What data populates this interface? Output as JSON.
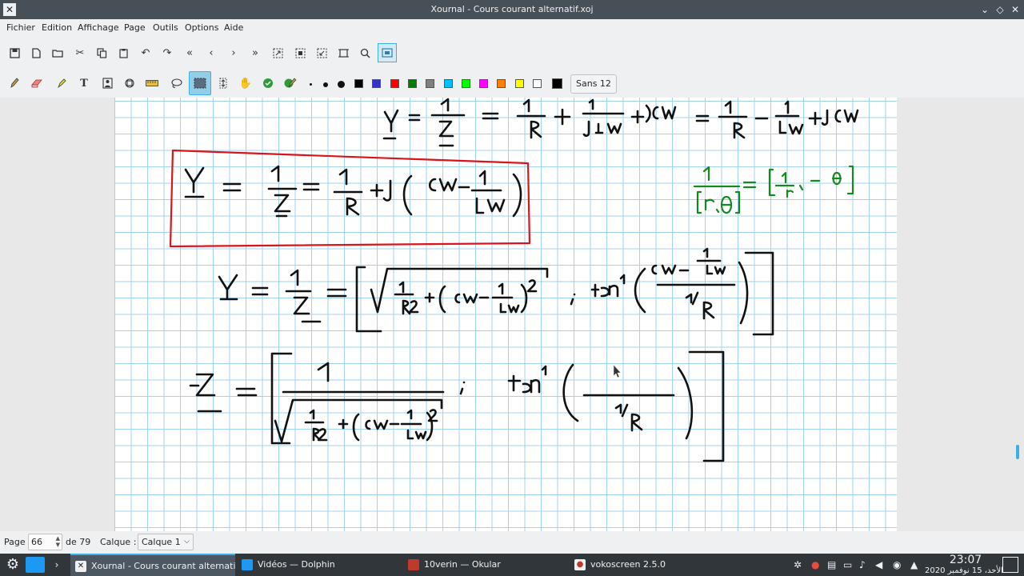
{
  "window": {
    "title": "Xournal - Cours courant alternatif.xoj",
    "controls": [
      "minimize",
      "keep-above",
      "close"
    ]
  },
  "menu": {
    "items": [
      "Fichier",
      "Edition",
      "Affichage",
      "Page",
      "Outils",
      "Options",
      "Aide"
    ]
  },
  "toolbar": {
    "font_label": "Sans 12",
    "colors": [
      "#000000",
      "#3333cc",
      "#ff0000",
      "#008000",
      "#808080",
      "#00c0ff",
      "#00ff00",
      "#ff00ff",
      "#ff8000",
      "#ffff00",
      "#ffffff",
      "#000000"
    ]
  },
  "ink_colors": {
    "black": "#111111",
    "red": "#d8141c",
    "green": "#128a1e",
    "grid": "#9fd3ee"
  },
  "status": {
    "page_label": "Page",
    "page_number": "66",
    "page_total": "de 79",
    "layer_label": "Calque :",
    "layer_value": "Calque 1"
  },
  "taskbar": {
    "tasks": [
      {
        "label": "Xournal - Cours courant alternatif....",
        "active": true
      },
      {
        "label": "Vidéos — Dolphin",
        "active": false
      },
      {
        "label": "10verin  — Okular",
        "active": false
      },
      {
        "label": "vokoscreen 2.5.0",
        "active": false
      }
    ],
    "clock_time": "23:07",
    "clock_date": "الأحد، 15 نوفمبر 2020"
  }
}
